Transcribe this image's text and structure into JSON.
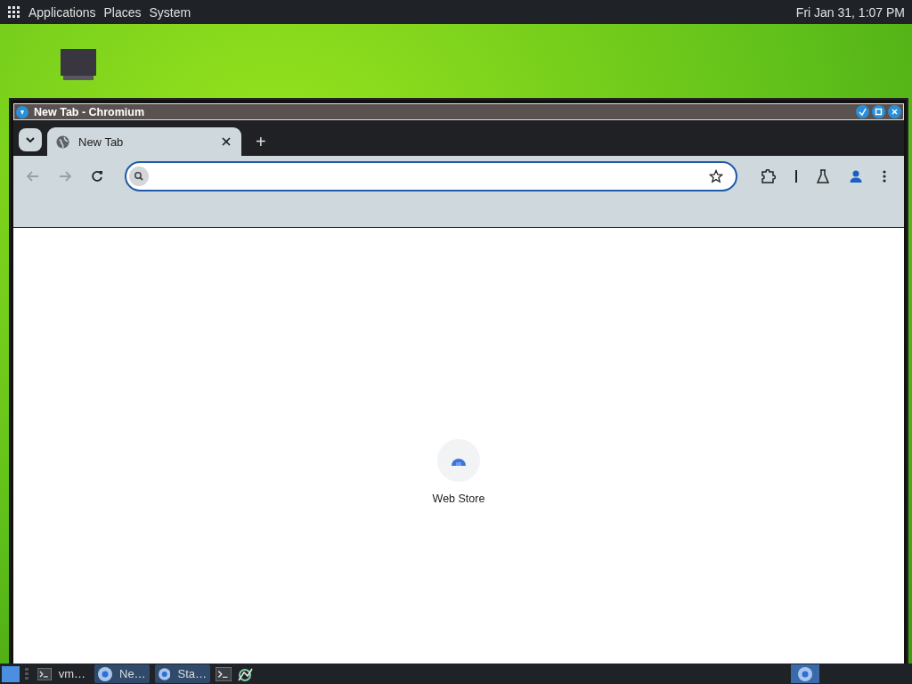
{
  "top_panel": {
    "menus": [
      "Applications",
      "Places",
      "System"
    ],
    "clock": "Fri Jan 31, 1:07 PM"
  },
  "window": {
    "title": "New Tab - Chromium"
  },
  "tabs": [
    {
      "label": "New Tab",
      "selected": true
    }
  ],
  "new_tab_button": "+",
  "shortcuts": [
    {
      "label": "Web Store"
    }
  ],
  "taskbar": [
    {
      "kind": "terminal",
      "label": "vm…",
      "selected": false
    },
    {
      "kind": "browser",
      "label": "Ne…",
      "selected": true
    },
    {
      "kind": "browser",
      "label": "Sta…",
      "selected": true
    }
  ]
}
